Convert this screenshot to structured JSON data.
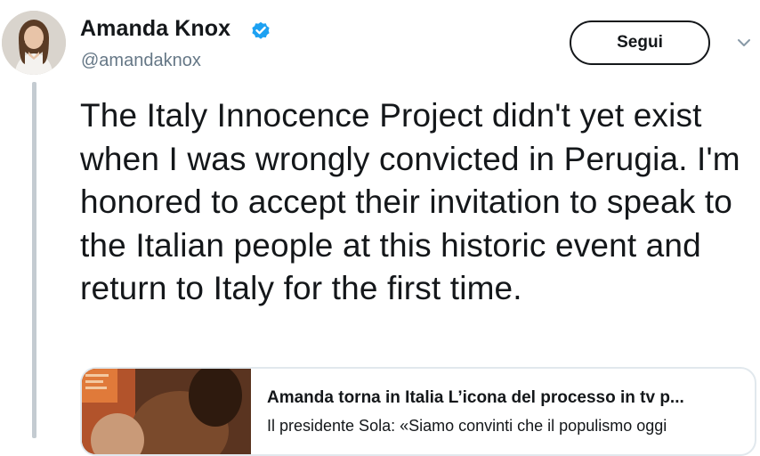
{
  "tweet": {
    "author": {
      "name": "Amanda Knox",
      "handle": "@amandaknox",
      "verified": true,
      "avatar": "avatar"
    },
    "follow_label": "Segui",
    "menu_icon": "chevron-down-icon",
    "text": "The Italy Innocence Project didn't yet exist when I was wrongly convicted in Perugia. I'm honored to accept their invitation to speak to the Italian people at this historic event and return to Italy for the first time.",
    "card": {
      "title": "Amanda torna in Italia L’icona del processo in tv p...",
      "description": "Il presidente Sola: «Siamo convinti che il populismo oggi"
    }
  },
  "colors": {
    "text": "#14171a",
    "secondary": "#657786",
    "verified": "#1da1f2",
    "border": "#e1e8ed",
    "thread_line": "#c4cbd1"
  }
}
